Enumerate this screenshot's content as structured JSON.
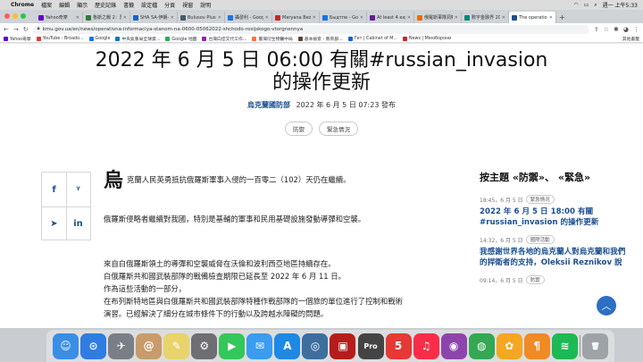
{
  "menubar": {
    "app": "Chrome",
    "items": [
      "檔案",
      "編輯",
      "顯示",
      "歷史記錄",
      "書籤",
      "設定檔",
      "分頁",
      "視窗",
      "說明"
    ],
    "clock": "週一 上午5:33"
  },
  "tabs": [
    {
      "title": "Yahoo奇摩",
      "color": "#6001d2"
    },
    {
      "title": "魯斯之戰 2：烈大",
      "color": "#2e7d32"
    },
    {
      "title": "SHA SA-伊朗-扎",
      "color": "#1565c0"
    },
    {
      "title": "Bulusov Plus",
      "color": "#455a64"
    },
    {
      "title": "攝發利 - Google",
      "color": "#1a73e8"
    },
    {
      "title": "Maryana Bezuli",
      "color": "#c62828"
    },
    {
      "title": "Быдтпе - Goog",
      "color": "#1a73e8"
    },
    {
      "title": "At least 4 expl",
      "color": "#6a1b9a"
    },
    {
      "title": "俄羅斯軍隊洞察",
      "color": "#ef6c00"
    },
    {
      "title": "數字金融界 20",
      "color": "#00897b"
    },
    {
      "title": "The operational",
      "color": "#1b4f8f",
      "active": true
    }
  ],
  "toolbar": {
    "url": "kmu.gov.ua/en/news/operativna-informaciya-stanom-na-0600-05062022-shchodo-rosijskogo-vtorgnennya"
  },
  "bookmarks": [
    {
      "label": "Yahoo奇摩",
      "color": "#6001d2"
    },
    {
      "label": "YouTube - Broado...",
      "color": "#e53935"
    },
    {
      "label": "Google",
      "color": "#1a73e8"
    },
    {
      "label": "中央氣象局全球資...",
      "color": "#0277bd"
    },
    {
      "label": "Google 地圖",
      "color": "#34a853"
    },
    {
      "label": "台灣向您交代工作...",
      "color": "#8e24aa"
    },
    {
      "label": "臺灣衍生物醫中局",
      "color": "#ff7043"
    },
    {
      "label": "基本檢索 - 教育部...",
      "color": "#5d4037"
    },
    {
      "label": "Гет | Cabinet of M...",
      "color": "#1565c0"
    },
    {
      "label": "News | Міноборони",
      "color": "#c62828"
    }
  ],
  "bookmarks_other": "其他書籤",
  "article": {
    "title_line1": "2022 年 6 月 5 日 06:00 有關#russian_invasion",
    "title_line2": "的操作更新",
    "author": "烏克蘭國防部",
    "date": "2022 年 6 月 5 日 07:23 發布",
    "tags": [
      "防禦",
      "緊急情況"
    ],
    "dropcap": "烏",
    "p1": "克蘭人民英勇抵抗俄羅斯軍事入侵的一百零二（102）天仍在繼續。",
    "p2": "俄羅斯侵略者繼續對我國，特別是基輔的軍事和民用基礎設施發動導彈和空襲。",
    "p3_l1": "來自白俄羅斯領土的導彈和空襲威脅在沃倫和波利西亞地區持續存在。",
    "p3_l2": "白俄羅斯共和國武裝部隊的戰備檢查期限已延長至 2022 年 6 月 11 日。",
    "p3_l3": "作為這些活動的一部分，",
    "p3_l4": "在布列斯特地區與白俄羅斯共和國武裝部隊特種作戰部隊的一個旅的單位進行了控制和戰術",
    "p3_l5": "演習。已經解決了細分在城市條件下的行動以及跨越水障礙的問題。"
  },
  "sidebar": {
    "title": "按主題 «防禦»、 «緊急»",
    "items": [
      {
        "time": "18:45，6 月 5 日",
        "tag": "緊急情況",
        "title": "2022 年 6 月 5 日 18:00 有關 #russian_invasion 的操作更新"
      },
      {
        "time": "14:32，6 月 5 日",
        "tag": "國際活動",
        "title": "我感謝世界各地的烏克蘭人對烏克蘭和我們的捍衛者的支持，Oleksii Reznikov 說"
      },
      {
        "time": "09:14，6 月 5 日",
        "tag": "防禦",
        "title": ""
      }
    ]
  },
  "dock": {
    "apps": [
      {
        "name": "finder",
        "color": "#3a8ee6",
        "glyph": "☺"
      },
      {
        "name": "safari",
        "color": "#2f7de1",
        "glyph": "⊙"
      },
      {
        "name": "launchpad",
        "color": "#7a7f87",
        "glyph": "✈"
      },
      {
        "name": "contacts",
        "color": "#c89b6a",
        "glyph": "@"
      },
      {
        "name": "notes",
        "color": "#e8d46a",
        "glyph": "✎"
      },
      {
        "name": "system-preferences",
        "color": "#6e6e73",
        "glyph": "⚙"
      },
      {
        "name": "facetime",
        "color": "#34c759",
        "glyph": "▶"
      },
      {
        "name": "mail",
        "color": "#3b9cf0",
        "glyph": "✉"
      },
      {
        "name": "app-store",
        "color": "#1e88e5",
        "glyph": "A"
      },
      {
        "name": "earth",
        "color": "#3d6e9e",
        "glyph": "◎"
      },
      {
        "name": "photo-booth",
        "color": "#b71c1c",
        "glyph": "▣"
      },
      {
        "name": "pro-app",
        "color": "#444",
        "glyph": "Pro"
      },
      {
        "name": "calendar",
        "color": "#e53935",
        "glyph": "5"
      },
      {
        "name": "music",
        "color": "#fa2d48",
        "glyph": "♫"
      },
      {
        "name": "podcasts",
        "color": "#8e44ad",
        "glyph": "◉"
      },
      {
        "name": "chrome",
        "color": "#34a853",
        "glyph": "◍"
      },
      {
        "name": "photos",
        "color": "#f5a623",
        "glyph": "✿"
      },
      {
        "name": "pages",
        "color": "#f08a24",
        "glyph": "¶"
      },
      {
        "name": "spotify",
        "color": "#1db954",
        "glyph": "≋"
      },
      {
        "name": "trash",
        "color": "#9ea3a8",
        "glyph": "🗑"
      }
    ]
  }
}
